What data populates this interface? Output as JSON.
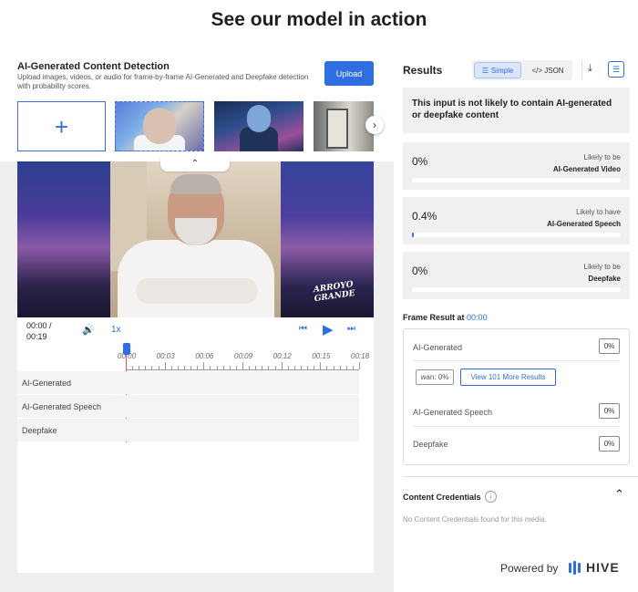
{
  "headline": "See our model in action",
  "left_panel": {
    "title": "AI-Generated Content Detection",
    "description": "Upload images, videos, or audio for frame-by-frame AI-Generated and Deepfake detection with probability scores.",
    "upload_label": "Upload",
    "add_symbol": "+",
    "video_logo_line1": "ARROYO",
    "video_logo_line2": "GRANDE"
  },
  "player": {
    "current_time": "00:00 /",
    "duration": "00:19",
    "speed": "1x"
  },
  "timeline": {
    "ticks": [
      "00:00",
      "00:03",
      "00:06",
      "00:09",
      "00:12",
      "00:15",
      "00:18"
    ],
    "tracks": [
      "AI-Generated",
      "AI-Generated Speech",
      "Deepfake"
    ]
  },
  "results": {
    "title": "Results",
    "toggle_simple": "Simple",
    "toggle_json": "</> JSON",
    "summary": "This input is not likely to contain AI-generated or deepfake content",
    "scores": [
      {
        "value": "0%",
        "fraction": 0.0,
        "label_top": "Likely to be",
        "label_bottom": "AI-Generated Video"
      },
      {
        "value": "0.4%",
        "fraction": 0.004,
        "label_top": "Likely to have",
        "label_bottom": "AI-Generated Speech"
      },
      {
        "value": "0%",
        "fraction": 0.0,
        "label_top": "Likely to be",
        "label_bottom": "Deepfake"
      }
    ],
    "accent_color": "#2f6ee0"
  },
  "frame_result": {
    "title_prefix": "Frame Result at",
    "time": "00:00",
    "ai_generated_label": "AI-Generated",
    "ai_generated_value": "0%",
    "chip_label": "wan: 0%",
    "more_label": "View 101 More Results",
    "speech_label": "AI-Generated Speech",
    "speech_value": "0%",
    "deepfake_label": "Deepfake",
    "deepfake_value": "0%"
  },
  "credentials": {
    "title": "Content Credentials",
    "info_symbol": "i",
    "empty_text": "No Content Credentials found for this media."
  },
  "footer": {
    "powered_by": "Powered by",
    "brand": "HIVE"
  }
}
